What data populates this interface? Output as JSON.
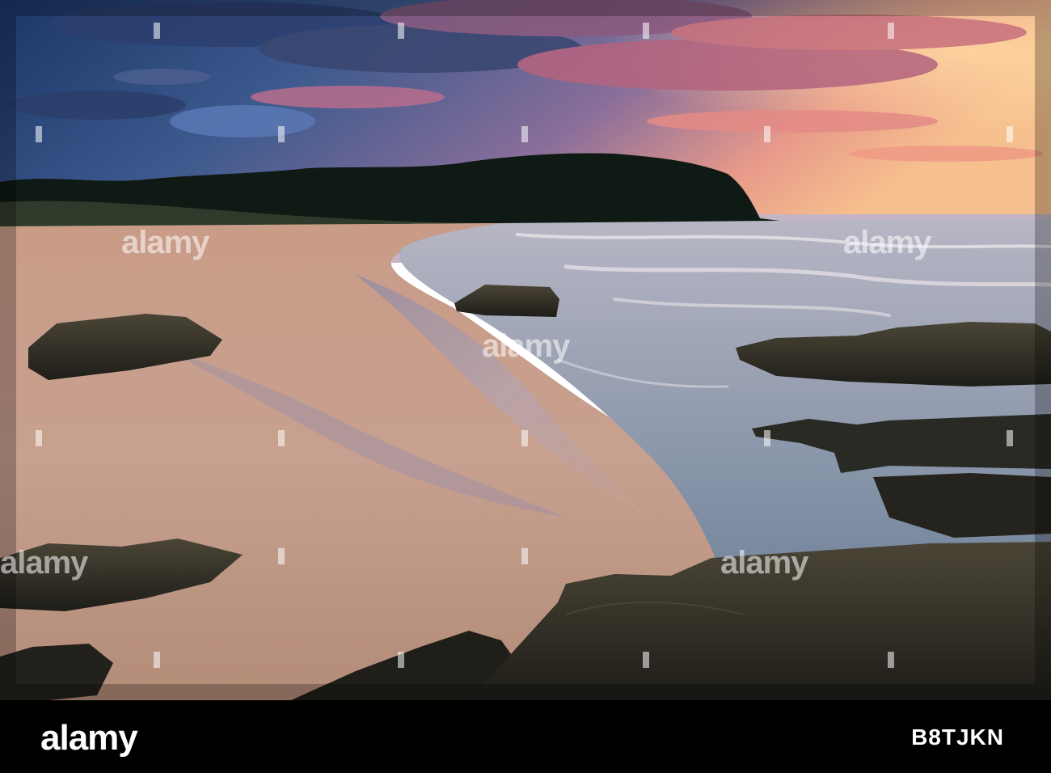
{
  "watermark": {
    "text": "alamy"
  },
  "footer": {
    "logo": "alamy",
    "image_id": "B8TJKN"
  },
  "colors": {
    "sky_top": "#1f3a6b",
    "sky_mid": "#5a78a8",
    "sunset_glow": "#f5b48a",
    "headland": "#0f1a14",
    "sand": "#c7a08f",
    "wet_sand": "#8f8fa6",
    "sea": "#6f8aa3",
    "rock": "#2a2a24"
  }
}
